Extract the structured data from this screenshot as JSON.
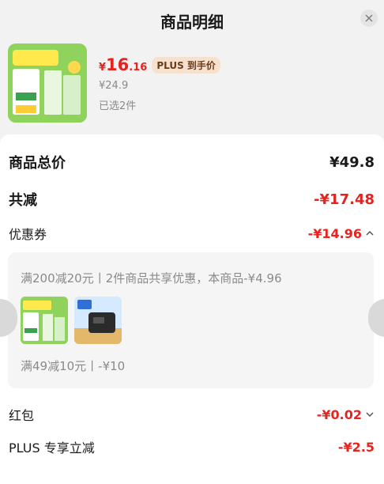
{
  "header": {
    "title": "商品明细"
  },
  "product": {
    "price_symbol": "¥",
    "price_integer": "16",
    "price_decimal": ".16",
    "plus_badge": "PLUS 到手价",
    "original_price": "¥24.9",
    "selected_count": "已选2件"
  },
  "summary": {
    "total_label": "商品总价",
    "total_value": "¥49.8",
    "discount_label": "共减",
    "discount_value": "-¥17.48"
  },
  "coupon": {
    "label": "优惠券",
    "value": "-¥14.96",
    "promo_1": "满200减20元丨2件商品共享优惠，本商品-¥4.96",
    "promo_2": "满49减10元丨-¥10"
  },
  "red_packet": {
    "label": "红包",
    "value": "-¥0.02"
  },
  "plus_discount": {
    "label": "PLUS 专享立减",
    "value": "-¥2.5"
  },
  "colors": {
    "accent_red": "#e8231f",
    "badge_bg": "#f6e1cf",
    "badge_text": "#6b3a17"
  },
  "icons": {
    "close": "close-icon",
    "chevron_up": "chevron-up-icon",
    "chevron_down": "chevron-down-icon"
  }
}
